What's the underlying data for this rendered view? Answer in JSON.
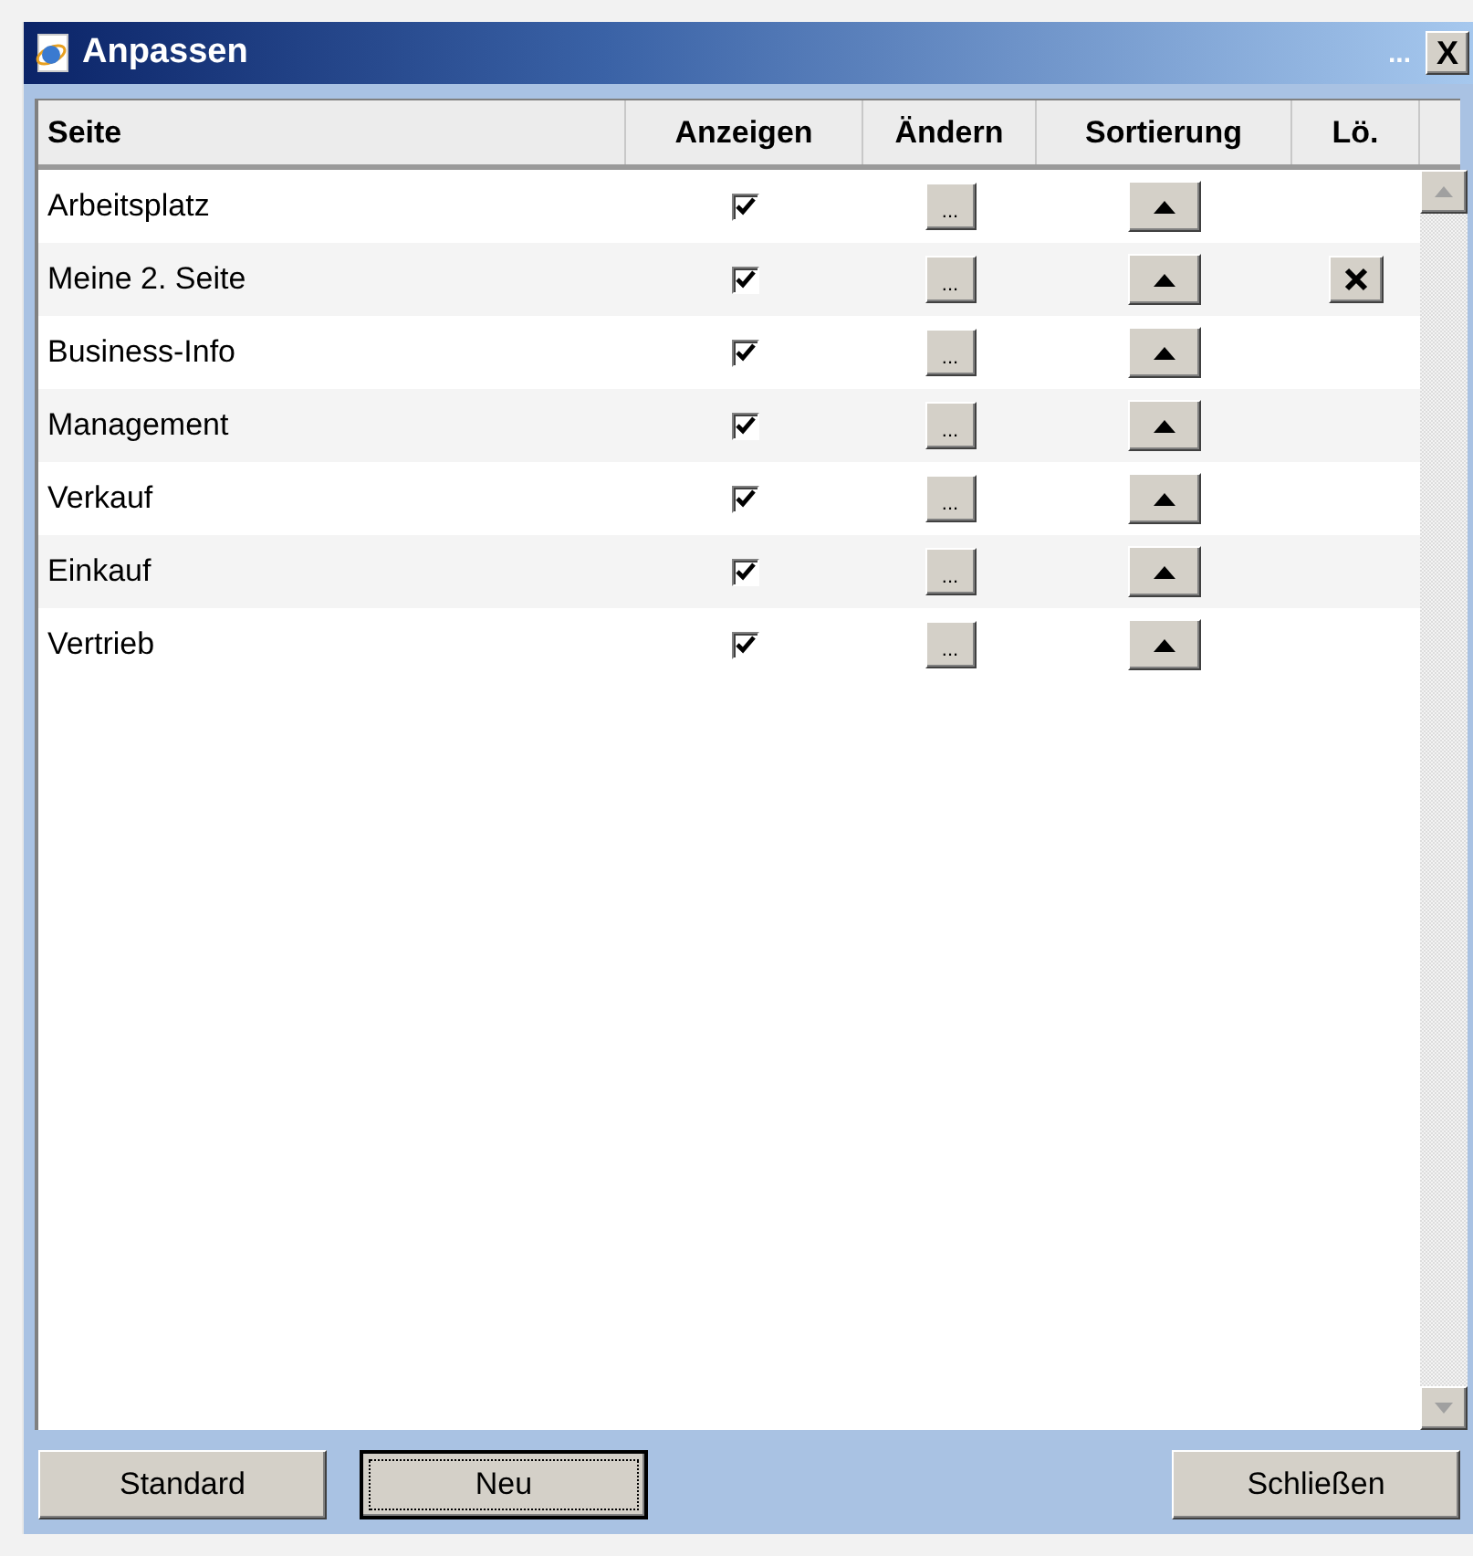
{
  "window": {
    "title": "Anpassen",
    "title_dots": "...",
    "close": "X"
  },
  "table": {
    "columns": [
      "Seite",
      "Anzeigen",
      "Ändern",
      "Sortierung",
      "Lö."
    ],
    "edit_label": "...",
    "rows": [
      {
        "name": "Arbeitsplatz",
        "checked": true,
        "deletable": false
      },
      {
        "name": "Meine 2. Seite",
        "checked": true,
        "deletable": true
      },
      {
        "name": "Business-Info",
        "checked": true,
        "deletable": false
      },
      {
        "name": "Management",
        "checked": true,
        "deletable": false
      },
      {
        "name": "Verkauf",
        "checked": true,
        "deletable": false
      },
      {
        "name": "Einkauf",
        "checked": true,
        "deletable": false
      },
      {
        "name": "Vertrieb",
        "checked": true,
        "deletable": false
      }
    ]
  },
  "buttons": [
    {
      "label": "Standard",
      "focused": false
    },
    {
      "label": "Neu",
      "focused": true
    },
    {
      "label": "Schließen",
      "focused": false
    }
  ]
}
